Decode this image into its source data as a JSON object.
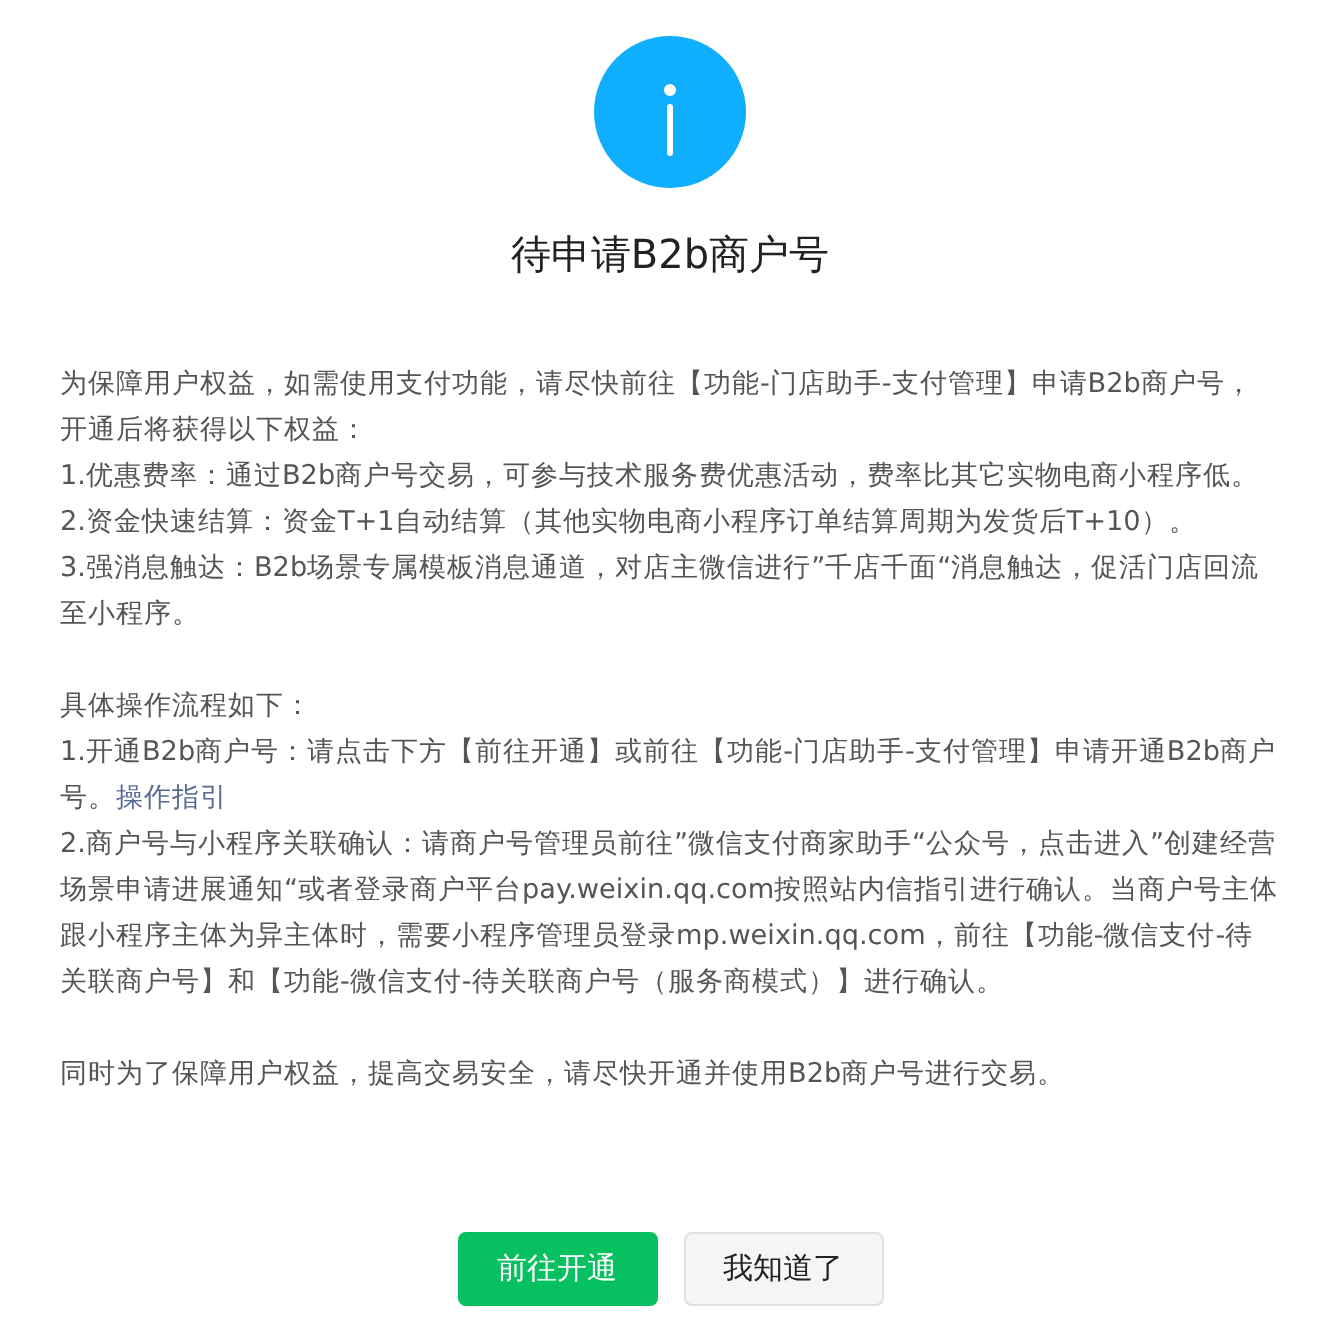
{
  "dialog": {
    "title": "待申请B2b商户号",
    "blocks": [
      [
        {
          "text": "为保障用户权益，如需使用支付功能，请尽快前往【功能-门店助手-支付管理】申请B2b商户号，开通后将获得以下权益："
        },
        {
          "text": "1.优惠费率：通过B2b商户号交易，可参与技术服务费优惠活动，费率比其它实物电商小程序低。"
        },
        {
          "text": "2.资金快速结算：资金T+1自动结算（其他实物电商小程序订单结算周期为发货后T+10）。"
        },
        {
          "text": "3.强消息触达：B2b场景专属模板消息通道，对店主微信进行”千店千面“消息触达，促活门店回流至小程序。"
        }
      ],
      [
        {
          "text": "具体操作流程如下："
        },
        {
          "text": "1.开通B2b商户号：请点击下方【前往开通】或前往【功能-门店助手-支付管理】申请开通B2b商户号。",
          "link": "操作指引"
        },
        {
          "text": "2.商户号与小程序关联确认：请商户号管理员前往”微信支付商家助手“公众号，点击进入”创建经营场景申请进展通知“或者登录商户平台pay.weixin.qq.com按照站内信指引进行确认。当商户号主体跟小程序主体为异主体时，需要小程序管理员登录mp.weixin.qq.com，前往【功能-微信支付-待关联商户号】和【功能-微信支付-待关联商户号（服务商模式）】进行确认。"
        }
      ],
      [
        {
          "text": "同时为了保障用户权益，提高交易安全，请尽快开通并使用B2b商户号进行交易。"
        }
      ]
    ],
    "buttons": [
      {
        "label": "前往开通",
        "kind": "primary"
      },
      {
        "label": "我知道了",
        "kind": "default"
      }
    ]
  }
}
